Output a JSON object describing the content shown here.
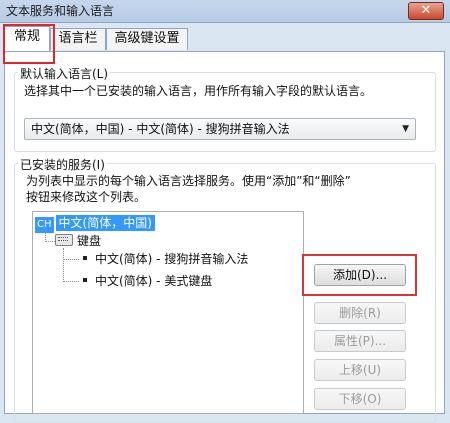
{
  "window": {
    "title": "文本服务和输入语言",
    "close_label": "✕"
  },
  "tabs": [
    {
      "label": "常规",
      "active": true
    },
    {
      "label": "语言栏",
      "active": false
    },
    {
      "label": "高级键设置",
      "active": false
    }
  ],
  "default_language": {
    "group_label": "默认输入语言(L)",
    "description": "选择其中一个已安装的输入语言，用作所有输入字段的默认语言。",
    "selected_value": "中文(简体，中国) - 中文(简体) - 搜狗拼音输入法",
    "arrow": "▼"
  },
  "installed_services": {
    "group_label": "已安装的服务(I)",
    "description_line1": "为列表中显示的每个输入语言选择服务。使用“添加”和“删除”",
    "description_line2": "按钮来修改这个列表。",
    "tree": {
      "language_code": "CH",
      "language_name": "中文(简体，中国)",
      "category": "键盘",
      "items": [
        "中文(简体) - 搜狗拼音输入法",
        "中文(简体) - 美式键盘"
      ]
    }
  },
  "buttons": {
    "add": "添加(D)...",
    "remove": "删除(R)",
    "properties": "属性(P)...",
    "move_up": "上移(U)",
    "move_down": "下移(O)"
  },
  "colors": {
    "selection": "#3399ff",
    "highlight_box": "#e0262a",
    "window_frame": "#dbe6f3"
  }
}
